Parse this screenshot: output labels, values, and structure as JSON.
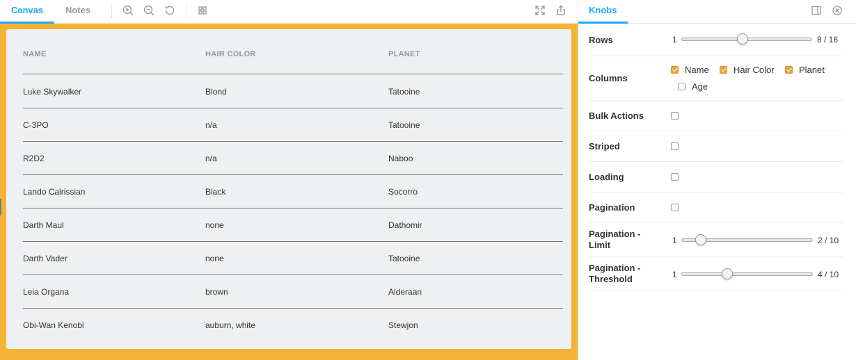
{
  "toolbar": {
    "tabs": [
      {
        "label": "Canvas"
      },
      {
        "label": "Notes"
      }
    ],
    "icons": [
      "zoom-in-icon",
      "zoom-out-icon",
      "reset-zoom-icon",
      "grid-icon",
      "fullscreen-icon",
      "share-icon"
    ]
  },
  "colors": {
    "accent": "#1ea7fd",
    "frame": "#f5b335",
    "checkbox_checked": "#e8a33c"
  },
  "table": {
    "headers": [
      "NAME",
      "HAIR COLOR",
      "PLANET"
    ],
    "rows": [
      [
        "Luke Skywalker",
        "Blond",
        "Tatooine"
      ],
      [
        "C-3PO",
        "n/a",
        "Tatooine"
      ],
      [
        "R2D2",
        "n/a",
        "Naboo"
      ],
      [
        "Lando Calrissian",
        "Black",
        "Socorro"
      ],
      [
        "Darth Maul",
        "none",
        "Dathomir"
      ],
      [
        "Darth Vader",
        "none",
        "Tatooine"
      ],
      [
        "Leia Organa",
        "brown",
        "Alderaan"
      ],
      [
        "Obi-Wan Kenobi",
        "auburn, white",
        "Stewjon"
      ]
    ]
  },
  "knobs": {
    "tab_label": "Knobs",
    "rows": {
      "label": "Rows",
      "min": "1",
      "value": 8,
      "max": 16,
      "display": "8 / 16"
    },
    "columns": {
      "label": "Columns",
      "options": [
        {
          "label": "Name",
          "checked": true
        },
        {
          "label": "Hair Color",
          "checked": true
        },
        {
          "label": "Planet",
          "checked": true
        },
        {
          "label": "Age",
          "checked": false
        }
      ]
    },
    "bulk_actions": {
      "label": "Bulk Actions",
      "checked": false
    },
    "striped": {
      "label": "Striped",
      "checked": false
    },
    "loading": {
      "label": "Loading",
      "checked": false
    },
    "pagination": {
      "label": "Pagination",
      "checked": false
    },
    "pagination_limit": {
      "label_line1": "Pagination -",
      "label_line2": "Limit",
      "min": "1",
      "value": 2,
      "max": 10,
      "display": "2 / 10"
    },
    "pagination_threshold": {
      "label_line1": "Pagination -",
      "label_line2": "Threshold",
      "min": "1",
      "value": 4,
      "max": 10,
      "display": "4 / 10"
    }
  }
}
